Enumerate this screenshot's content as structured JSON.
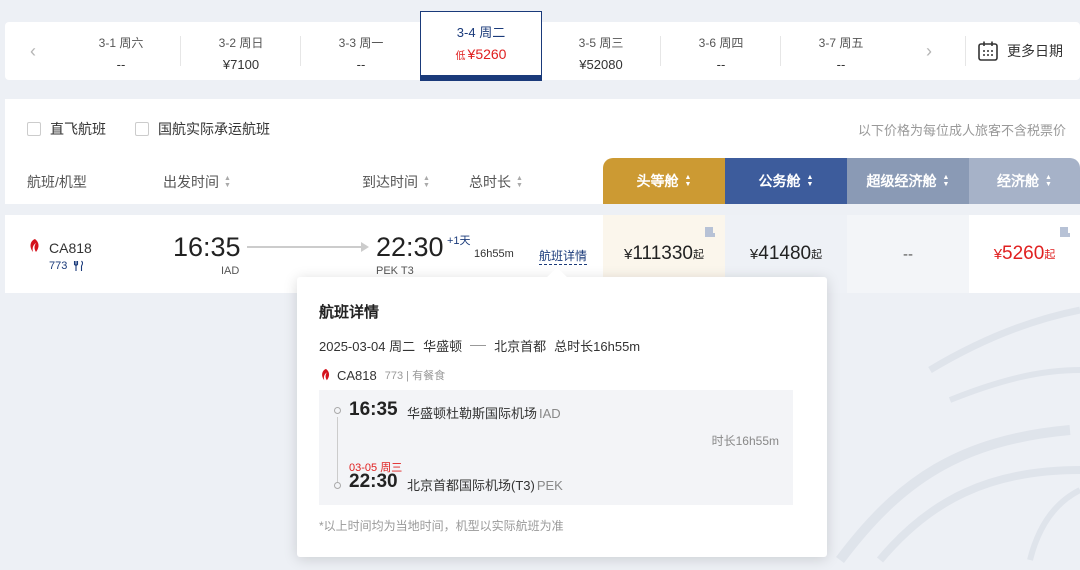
{
  "date_strip": {
    "prev_label": "‹",
    "next_label": "›",
    "dates": [
      {
        "day": "3-1 周六",
        "price": "--"
      },
      {
        "day": "3-2 周日",
        "price": "¥7100"
      },
      {
        "day": "3-3 周一",
        "price": "--"
      },
      {
        "day": "3-4 周二",
        "price": "¥5260",
        "low_badge": "低",
        "active": true
      },
      {
        "day": "3-5 周三",
        "price": "¥52080"
      },
      {
        "day": "3-6 周四",
        "price": "--"
      },
      {
        "day": "3-7 周五",
        "price": "--"
      }
    ],
    "more_dates": "更多日期"
  },
  "filters": {
    "direct": "直飞航班",
    "air_china_operated": "国航实际承运航班",
    "note": "以下价格为每位成人旅客不含税票价"
  },
  "columns": {
    "flight": "航班/机型",
    "depart": "出发时间",
    "arrive": "到达时间",
    "duration": "总时长"
  },
  "cabins": {
    "first": "头等舱",
    "business": "公务舱",
    "premium_economy": "超级经济舱",
    "economy": "经济舱"
  },
  "flight": {
    "number": "CA818",
    "aircraft": "773",
    "dep_time": "16:35",
    "dep_airport": "IAD",
    "arr_time": "22:30",
    "plus_day": "+1天",
    "arr_airport": "PEK T3",
    "duration": "16h55m",
    "detail_link": "航班详情",
    "prices": {
      "first": {
        "currency": "¥",
        "value": "111330",
        "suffix": "起"
      },
      "business": {
        "currency": "¥",
        "value": "41480",
        "suffix": "起"
      },
      "premium_economy": "--",
      "economy": {
        "currency": "¥",
        "value": "5260",
        "suffix": "起"
      }
    }
  },
  "popup": {
    "title": "航班详情",
    "date": "2025-03-04 周二",
    "from_city": "华盛顿",
    "to_city": "北京首都",
    "total_duration": "总时长16h55m",
    "flight_number": "CA818",
    "flight_meta": "773 | 有餐食",
    "dep": {
      "time": "16:35",
      "airport": "华盛顿杜勒斯国际机场",
      "code": "IAD"
    },
    "segment_duration": "时长16h55m",
    "arr": {
      "date": "03-05 周三",
      "time": "22:30",
      "airport": "北京首都国际机场(T3)",
      "code": "PEK"
    },
    "footnote": "*以上时间均为当地时间，机型以实际航班为准"
  },
  "colors": {
    "navy": "#1a3a7a",
    "gold": "#cc9a33",
    "red": "#e02020"
  }
}
